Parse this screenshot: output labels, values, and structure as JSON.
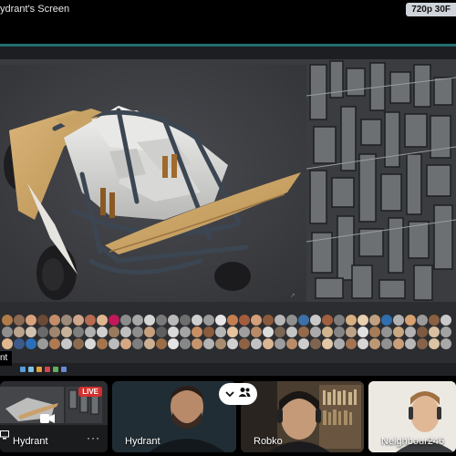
{
  "header": {
    "screen_title": "ydrant's Screen",
    "quality_badge": "720p 30F"
  },
  "stream": {
    "presenter_tag": "nt",
    "left_viewport": "vehicle-chassis-render",
    "right_viewport": "panel-wireframe-render"
  },
  "participants": [
    {
      "name": "Hydrant",
      "badge": "LIVE",
      "menu": "···",
      "icon": "camera-icon"
    },
    {
      "name": "Hydrant"
    },
    {
      "name": "Robko"
    },
    {
      "name": "Neighbour246"
    }
  ],
  "controls": {
    "chevron": "chevron-down-icon",
    "people": "people-icon"
  },
  "colors": {
    "accent_teal": "#1f6f6f",
    "live_red": "#d3302f",
    "badge_bg": "#cfd4da"
  }
}
